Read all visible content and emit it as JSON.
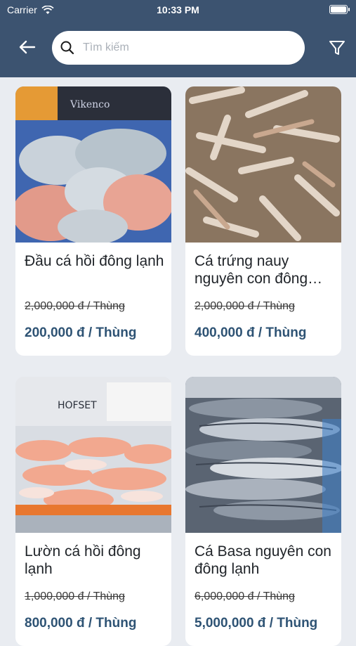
{
  "status_bar": {
    "carrier": "Carrier",
    "time": "10:33 PM"
  },
  "search": {
    "placeholder": "Tìm kiếm"
  },
  "products": [
    {
      "title": "Đầu cá hồi đông lạnh",
      "old_price": "2,000,000 đ / Thùng",
      "price": "200,000 đ / Thùng",
      "image": "salmon-heads-photo"
    },
    {
      "title": "Cá trứng nauy nguyên con đông lạnh",
      "old_price": "2,000,000 đ / Thùng",
      "price": "400,000 đ / Thùng",
      "image": "capelin-fish-photo"
    },
    {
      "title": "Lườn cá hồi đông lạnh",
      "old_price": "1,000,000 đ / Thùng",
      "price": "800,000 đ / Thùng",
      "image": "salmon-belly-photo"
    },
    {
      "title": "Cá Basa nguyên con đông lạnh",
      "old_price": "6,000,000 đ / Thùng",
      "price": "5,000,000 đ / Thùng",
      "image": "whole-fish-photo"
    }
  ],
  "image_labels": {
    "brand_1": "Vikenco",
    "brand_2": "HOFSET"
  },
  "colors": {
    "header": "#3c5370",
    "price": "#2e5374",
    "background": "#e9ecf1"
  }
}
